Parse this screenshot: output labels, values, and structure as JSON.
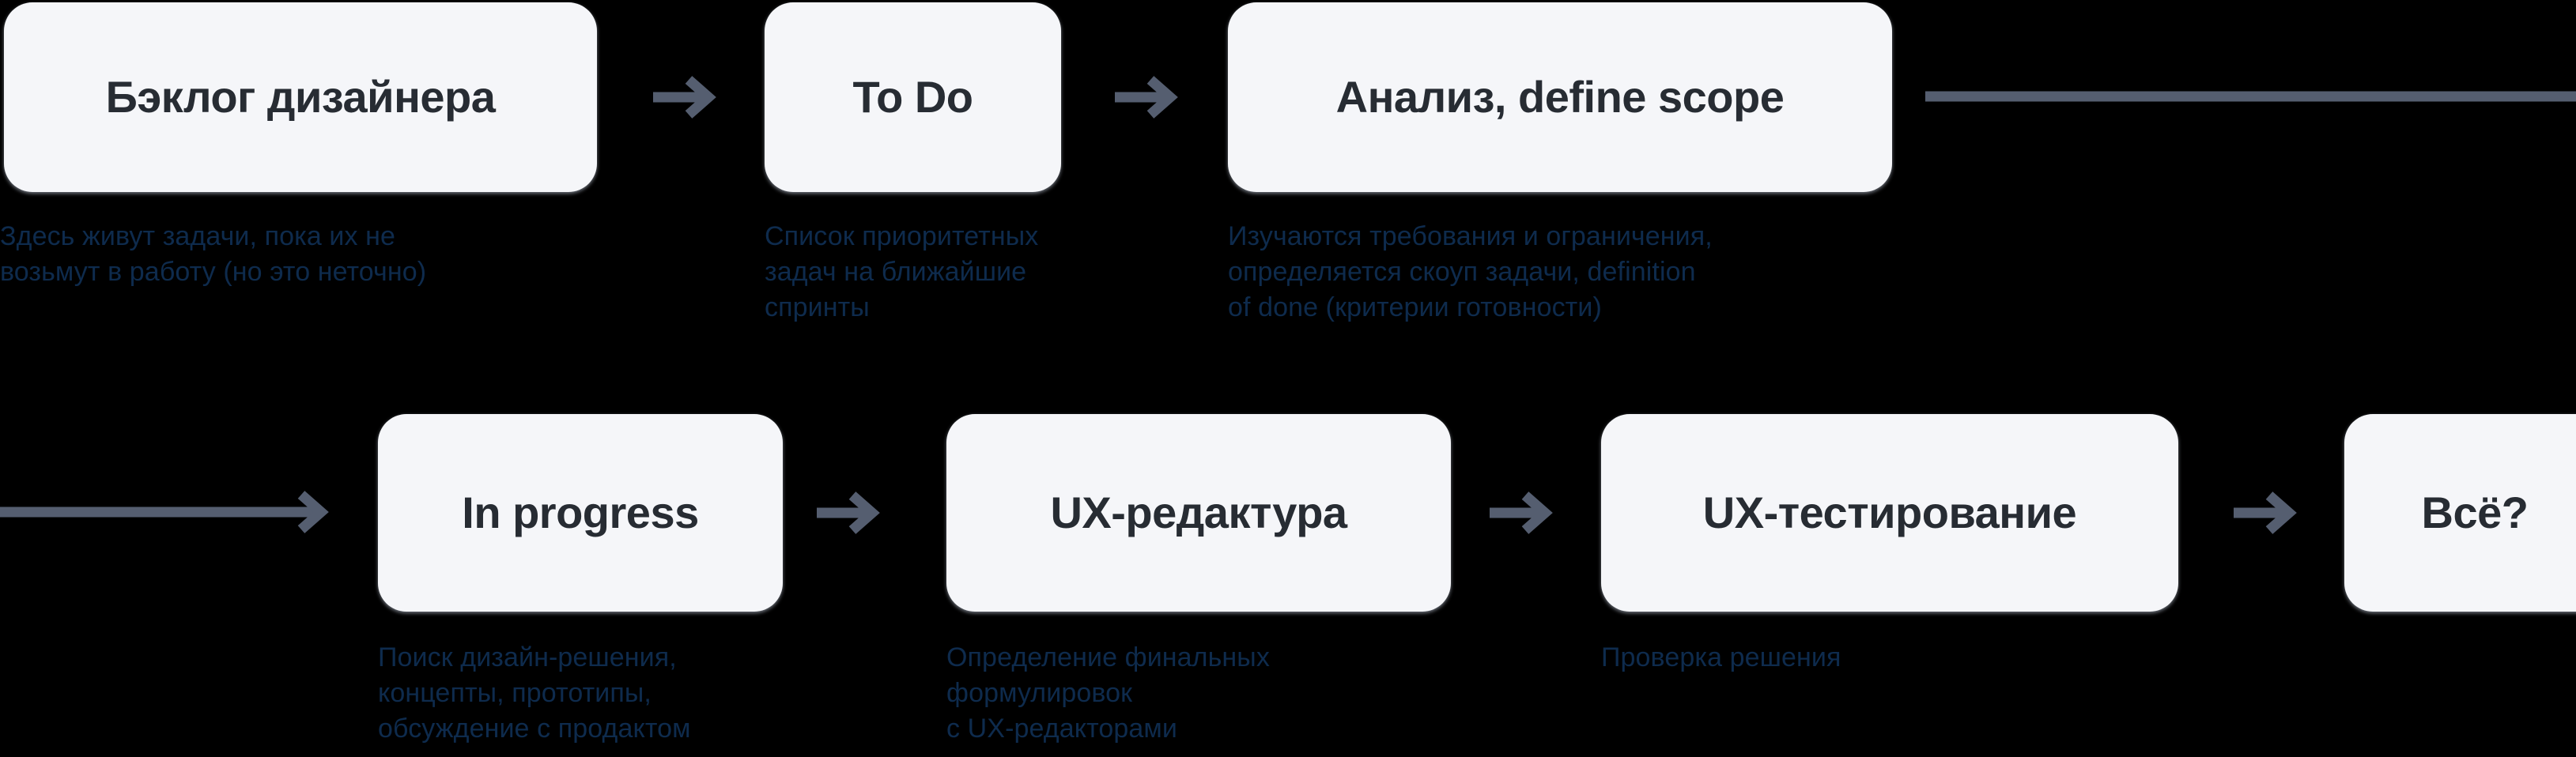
{
  "diagram": {
    "title_text": "",
    "colors": {
      "background": "#000000",
      "node_fill": "#f5f6f9",
      "node_text": "#272c33",
      "caption_text": "#0e2b4d",
      "arrow": "#555e70"
    },
    "rows": [
      {
        "id": "row-1",
        "nodes": [
          {
            "id": "backlog",
            "label": "Бэклог дизайнера",
            "caption": "Здесь живут задачи, пока их не\nвозьмут в работу (но это неточно)"
          },
          {
            "id": "todo",
            "label": "To Do",
            "caption": "Список приоритетных\nзадач на ближайшие\nспринты"
          },
          {
            "id": "analysis",
            "label": "Анализ, define scope",
            "caption": "Изучаются требования и ограничения,\nопределяется скоуп задачи, definition\nof done (критерии готовности)"
          }
        ]
      },
      {
        "id": "row-2",
        "nodes": [
          {
            "id": "in-progress",
            "label": "In progress",
            "caption": "Поиск дизайн-решения,\nконцепты, прототипы,\nобсуждение с продактом"
          },
          {
            "id": "ux-editing",
            "label": "UX-редактура",
            "caption": "Определение финальных\nформулировок\nс UX-редакторами"
          },
          {
            "id": "ux-testing",
            "label": "UX-тестирование",
            "caption": "Проверка решения"
          },
          {
            "id": "done",
            "label": "Всё?",
            "caption": ""
          }
        ]
      }
    ],
    "connectors": [
      {
        "id": "arrow-backlog-to-todo",
        "kind": "arrow-right"
      },
      {
        "id": "arrow-todo-to-analysis",
        "kind": "arrow-right"
      },
      {
        "id": "line-analysis-wrap-out",
        "kind": "line-right"
      },
      {
        "id": "line-wrap-in-to-in-progress",
        "kind": "long-arrow-right"
      },
      {
        "id": "arrow-in-progress-to-ux-editing",
        "kind": "arrow-right"
      },
      {
        "id": "arrow-ux-editing-to-ux-testing",
        "kind": "arrow-right"
      },
      {
        "id": "arrow-ux-testing-to-done",
        "kind": "arrow-right"
      }
    ]
  }
}
